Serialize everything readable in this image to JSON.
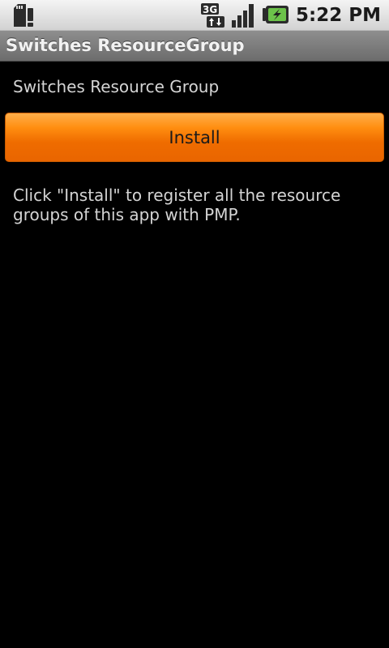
{
  "status_bar": {
    "icons": [
      "sd-card-warning-icon",
      "network-3g-icon",
      "signal-strength-icon",
      "battery-charging-icon"
    ],
    "network_label": "3G",
    "time": "5:22 PM"
  },
  "title_bar": {
    "title": "Switches ResourceGroup"
  },
  "content": {
    "heading": "Switches Resource Group",
    "install_button_label": "Install",
    "description": "Click \"Install\" to register all the resource groups of this app with PMP."
  },
  "colors": {
    "background": "#000000",
    "button_orange": "#ef6c00",
    "text_light": "#d4d4d4"
  }
}
